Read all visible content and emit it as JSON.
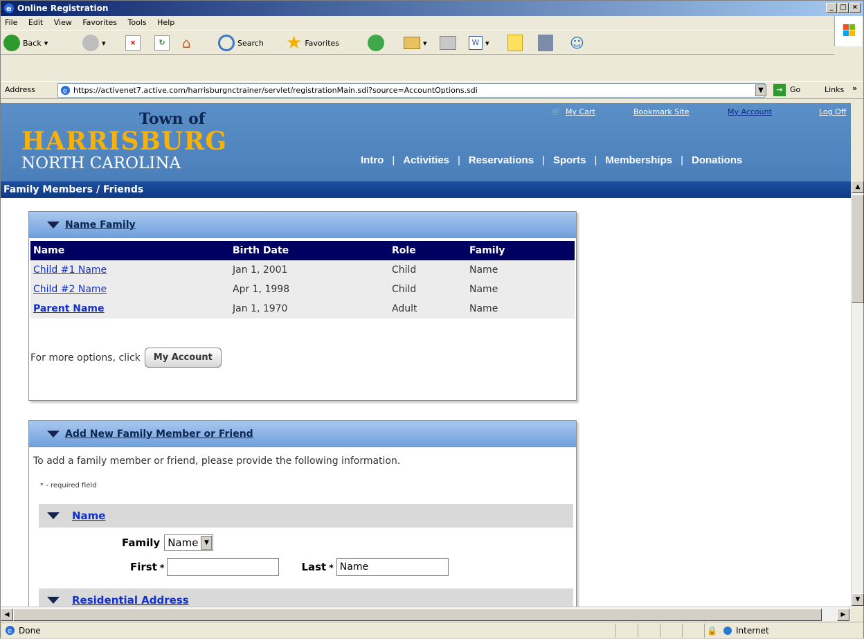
{
  "window": {
    "title": "Online Registration"
  },
  "menu": [
    "File",
    "Edit",
    "View",
    "Favorites",
    "Tools",
    "Help"
  ],
  "toolbar": {
    "back": "Back",
    "search": "Search",
    "favorites": "Favorites"
  },
  "address": {
    "label": "Address",
    "url": "https://activenet7.active.com/harrisburgnctrainer/servlet/registrationMain.sdi?source=AccountOptions.sdi",
    "go": "Go",
    "links": "Links"
  },
  "banner": {
    "town_of": "Town of",
    "name": "HARRISBURG",
    "state": "NORTH CAROLINA",
    "top_links": [
      "My Cart",
      "Bookmark Site",
      "My Account",
      "Log Off"
    ],
    "nav": [
      "Intro",
      "Activities",
      "Reservations",
      "Sports",
      "Memberships",
      "Donations"
    ]
  },
  "page_title": "Family Members / Friends",
  "family_panel": {
    "title": "Name Family",
    "columns": [
      "Name",
      "Birth Date",
      "Role",
      "Family"
    ],
    "rows": [
      {
        "name": "Child #1 Name",
        "birth": "Jan 1, 2001",
        "role": "Child",
        "family": "Name"
      },
      {
        "name": "Child #2 Name",
        "birth": "Apr 1, 1998",
        "role": "Child",
        "family": "Name"
      },
      {
        "name": "Parent Name",
        "birth": "Jan 1, 1970",
        "role": "Adult",
        "family": "Name"
      }
    ],
    "more_text": "For more options, click",
    "button": "My Account"
  },
  "add_panel": {
    "title": "Add New Family Member or Friend",
    "instructions": "To add a family member or friend, please provide the following information.",
    "required_note": "* - required field",
    "section_name": "Name",
    "family_label": "Family",
    "family_value": "Name",
    "first_label": "First",
    "first_value": "",
    "last_label": "Last",
    "last_value": "Name",
    "section_address": "Residential Address"
  },
  "status": {
    "text": "Done",
    "zone": "Internet"
  }
}
